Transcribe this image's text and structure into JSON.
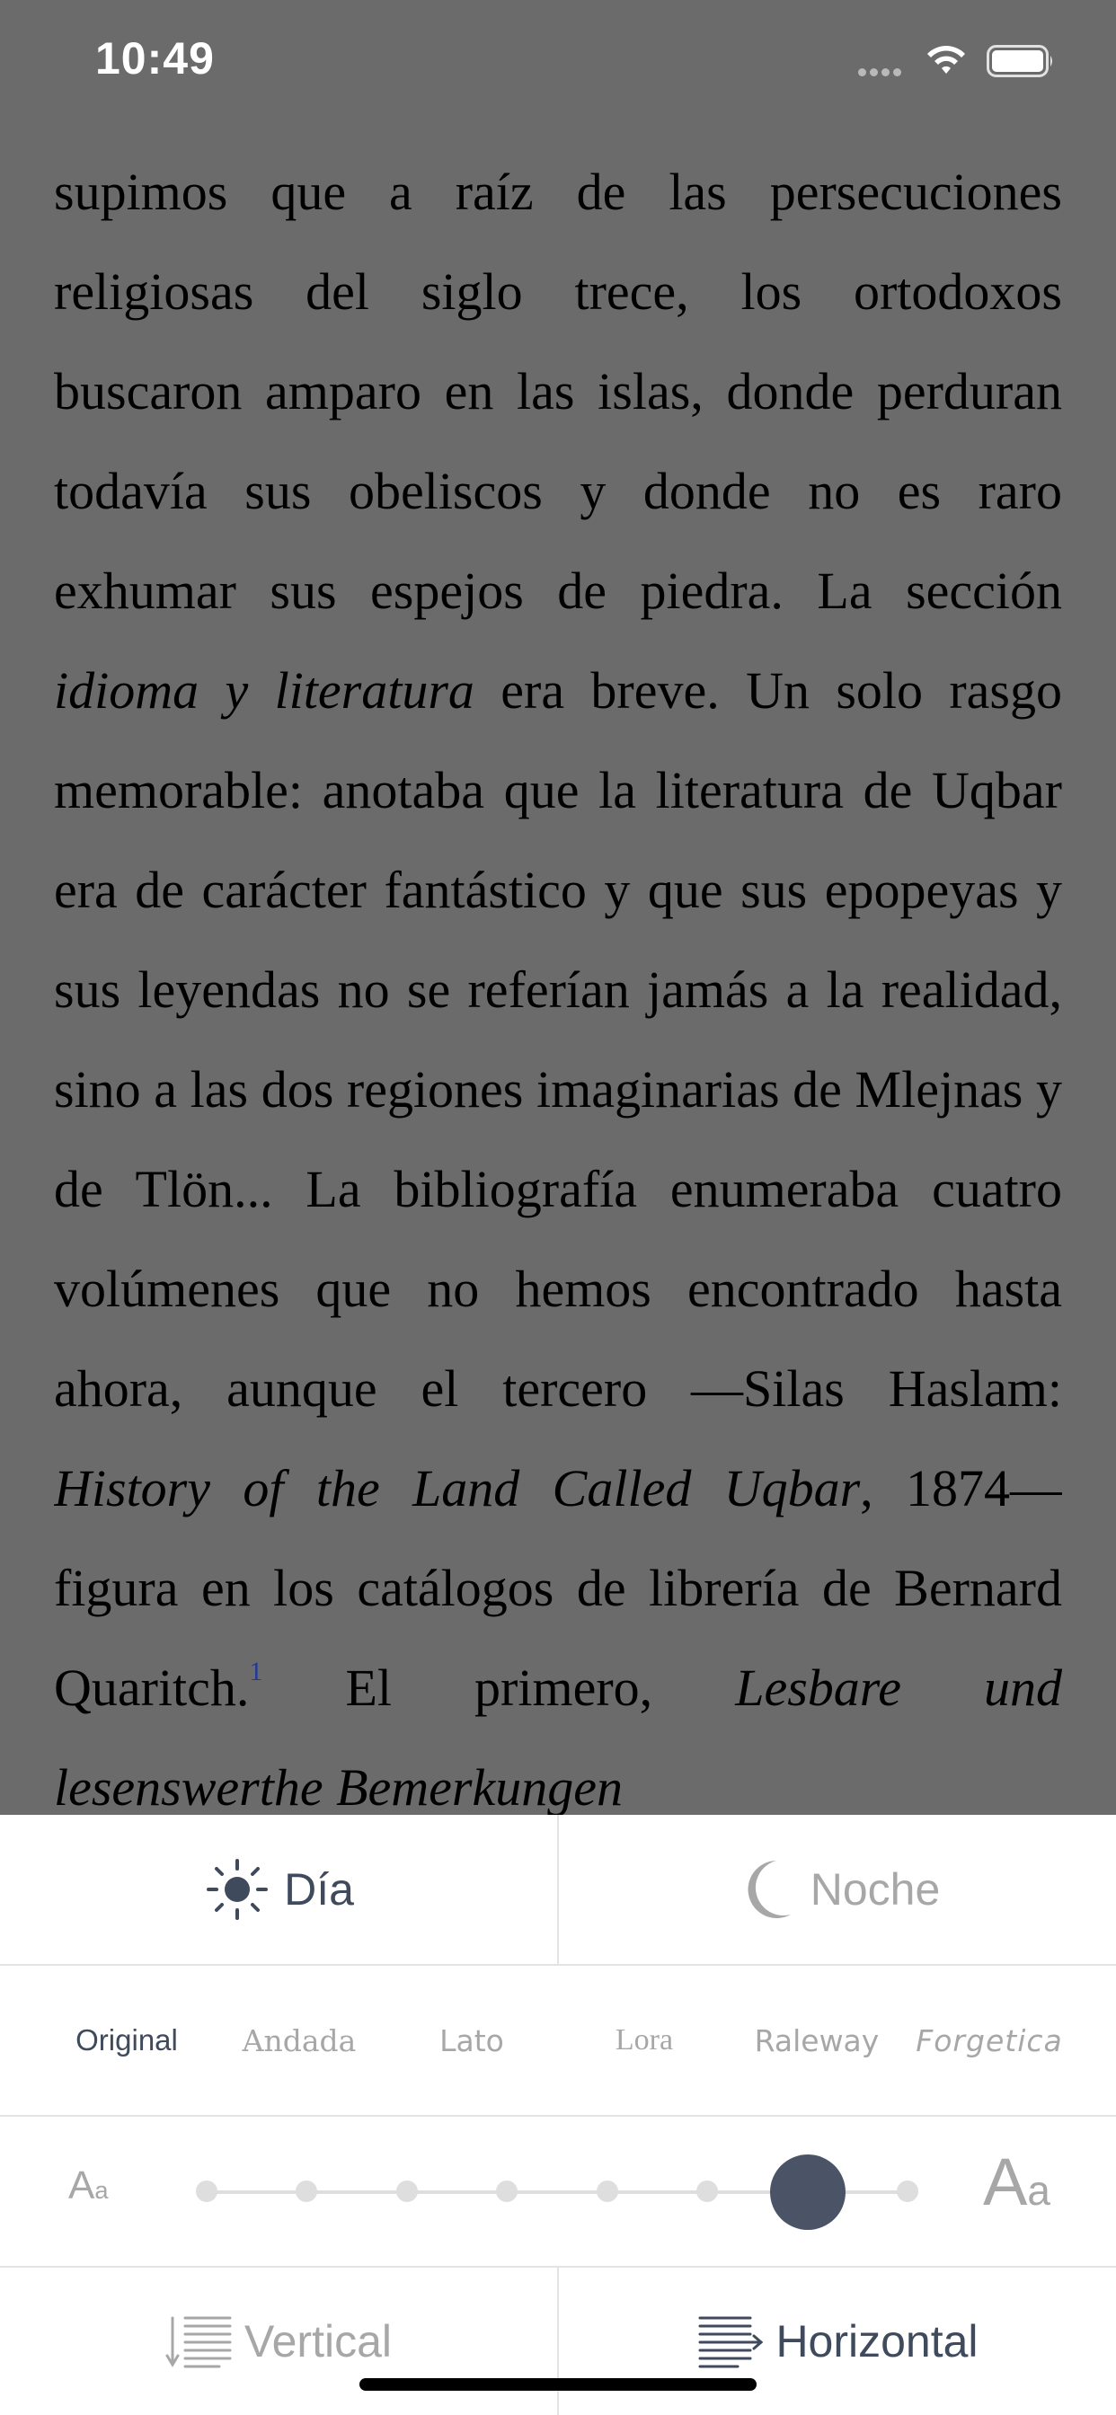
{
  "status_bar": {
    "time": "10:49"
  },
  "reader": {
    "text_color": "#000000",
    "background": "#6b6b6b",
    "paragraph": {
      "t1": "supimos que a raíz de las persecuciones religiosas del siglo trece, los ortodoxos buscaron amparo en las islas, donde perduran todavía sus obeliscos y donde no es raro exhumar sus espejos de piedra. La sección ",
      "i1": "idioma y literatura",
      "t2": " era breve. Un solo rasgo memorable: anotaba que la literatura de Uqbar era de carácter fantástico y que sus epopeyas y sus leyendas no se referían jamás a la realidad, sino a las dos regiones imaginarias de Mlejnas y de Tlön... La bibliografía enumeraba cuatro volúmenes que no hemos encontrado hasta ahora, aunque el tercero —Silas Haslam: ",
      "i2": "History of the Land Called Uqbar",
      "t3": ", 1874— figura en los catálogos de librería de Bernard Quaritch.",
      "footnote": "1",
      "t4": " El primero, ",
      "i3": "Lesbare und lesenswerthe Bemerkungen"
    }
  },
  "settings": {
    "theme": {
      "day_label": "Día",
      "night_label": "Noche",
      "selected": "day",
      "day_icon": "sun-icon",
      "night_icon": "moon-icon"
    },
    "fonts": {
      "selected": "Original",
      "options": [
        "Original",
        "Andada",
        "Lato",
        "Lora",
        "Raleway",
        "Forgetica"
      ]
    },
    "font_size": {
      "small_glyph": "A",
      "small_glyph_sub": "a",
      "large_glyph": "A",
      "large_glyph_sub": "a",
      "steps": 8,
      "selected_step": 6
    },
    "scroll_mode": {
      "vertical_label": "Vertical",
      "horizontal_label": "Horizontal",
      "selected": "horizontal",
      "vertical_icon": "vertical-lines-icon",
      "horizontal_icon": "horizontal-lines-icon"
    }
  },
  "colors": {
    "accent": "#4a5466",
    "active_text": "#3f4a5c",
    "inactive_text": "#a7a7a7",
    "divider": "#e3e3e3"
  }
}
